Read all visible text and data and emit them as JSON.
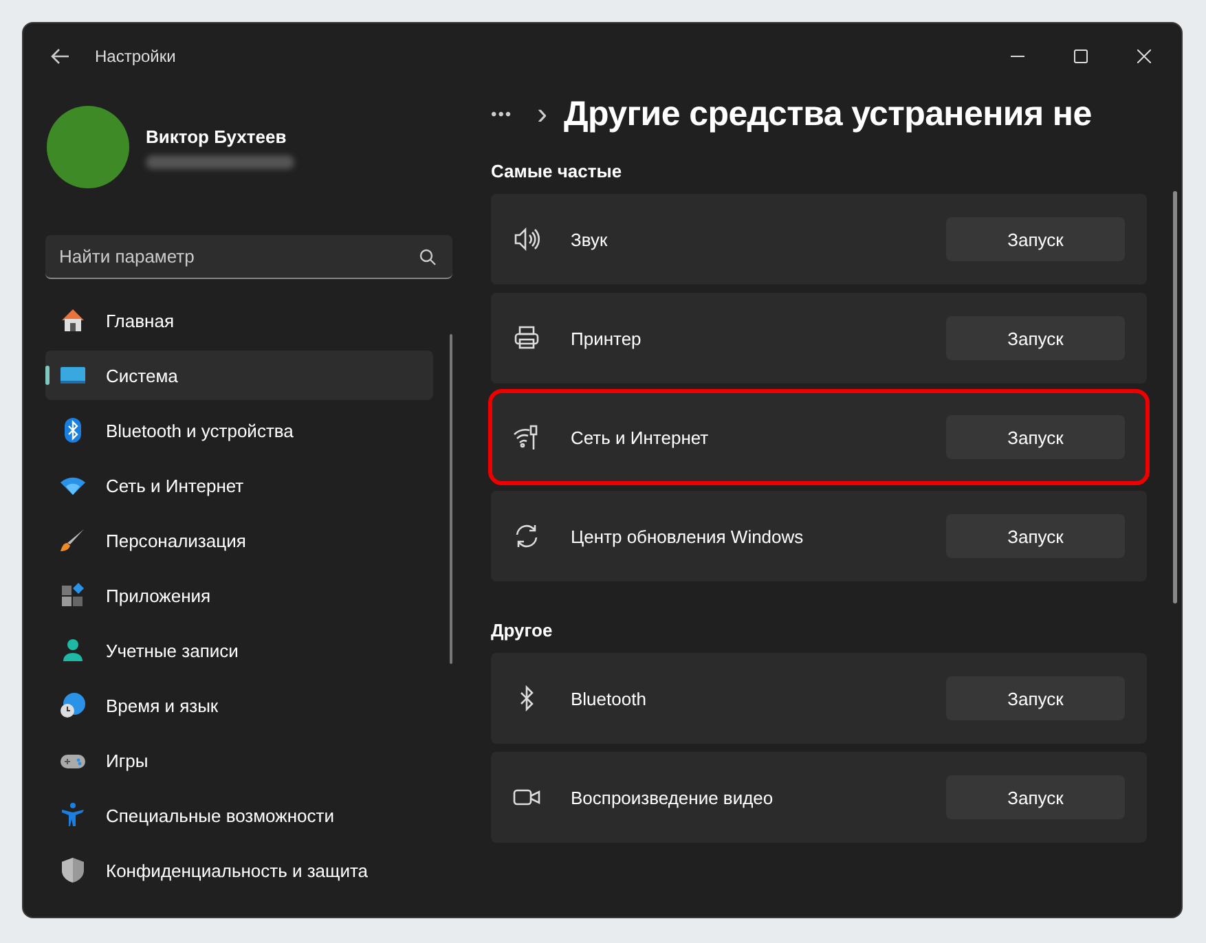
{
  "window": {
    "title": "Настройки"
  },
  "account": {
    "name": "Виктор Бухтеев"
  },
  "search": {
    "placeholder": "Найти параметр"
  },
  "sidebar": {
    "items": [
      {
        "label": "Главная",
        "selected": false
      },
      {
        "label": "Система",
        "selected": true
      },
      {
        "label": "Bluetooth и устройства",
        "selected": false
      },
      {
        "label": "Сеть и Интернет",
        "selected": false
      },
      {
        "label": "Персонализация",
        "selected": false
      },
      {
        "label": "Приложения",
        "selected": false
      },
      {
        "label": "Учетные записи",
        "selected": false
      },
      {
        "label": "Время и язык",
        "selected": false
      },
      {
        "label": "Игры",
        "selected": false
      },
      {
        "label": "Специальные возможности",
        "selected": false
      },
      {
        "label": "Конфиденциальность и защита",
        "selected": false
      }
    ]
  },
  "breadcrumb": {
    "more": "•••",
    "separator": "›",
    "title": "Другие средства устранения не"
  },
  "sections": [
    {
      "heading": "Самые частые",
      "items": [
        {
          "label": "Звук",
          "button": "Запуск",
          "highlighted": false
        },
        {
          "label": "Принтер",
          "button": "Запуск",
          "highlighted": false
        },
        {
          "label": "Сеть и Интернет",
          "button": "Запуск",
          "highlighted": true
        },
        {
          "label": "Центр обновления Windows",
          "button": "Запуск",
          "highlighted": false
        }
      ]
    },
    {
      "heading": "Другое",
      "items": [
        {
          "label": "Bluetooth",
          "button": "Запуск",
          "highlighted": false
        },
        {
          "label": "Воспроизведение видео",
          "button": "Запуск",
          "highlighted": false
        }
      ]
    }
  ]
}
